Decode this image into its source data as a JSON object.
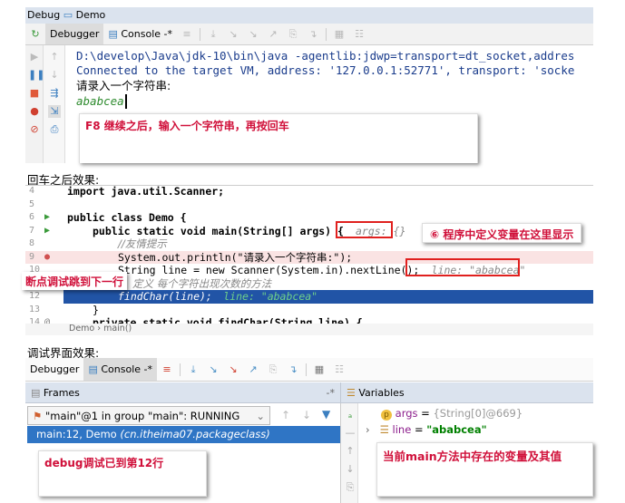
{
  "top": {
    "title_debug": "Debug",
    "title_config": "Demo",
    "tabs": [
      "Debugger",
      "Console"
    ],
    "console_lines": [
      "D:\\develop\\Java\\jdk-10\\bin\\java -agentlib:jdwp=transport=dt_socket,addres",
      "Connected to the target VM, address: '127.0.0.1:52771', transport: 'socke",
      "请录入一个字符串:"
    ],
    "input_value": "ababcea",
    "note": "F8 继续之后，输入一个字符串，再按回车"
  },
  "editor_section": {
    "label": "回车之后效果:",
    "lines": [
      {
        "n": "4",
        "code": "import java.util.Scanner;"
      },
      {
        "n": "5",
        "code": ""
      },
      {
        "n": "6",
        "code": "public class Demo {"
      },
      {
        "n": "7",
        "code": "public static void main(String[] args) {",
        "hint": "args: {}"
      },
      {
        "n": "8",
        "code": "//友情提示"
      },
      {
        "n": "9",
        "code": "System.out.println(\"请录入一个字符串:\");"
      },
      {
        "n": "10",
        "code": "String line = new Scanner(System.in).nextLine();",
        "hint": "line: \"ababcea\""
      },
      {
        "n": "11",
        "code": "定义 每个字符出现次数的方法"
      },
      {
        "n": "12",
        "code": "findChar(line);",
        "hint": "line: \"ababcea\""
      },
      {
        "n": "13",
        "code": "}"
      },
      {
        "n": "14",
        "code": "private static void findChar(String line) {"
      }
    ],
    "note_vars": "⑥ 程序中定义变量在这里显示",
    "note_step": "断点调试跳到下一行",
    "breadcrumb": [
      "Demo",
      "main()"
    ]
  },
  "debug_section": {
    "label": "调试界面效果:",
    "tabs": [
      "Debugger",
      "Console"
    ],
    "frames_title": "Frames",
    "variables_title": "Variables",
    "thread": "\"main\"@1 in group \"main\": RUNNING",
    "frame_selected": "main:12, Demo",
    "frame_package": "(cn.itheima07.packageclass)",
    "note_frames": "debug调试已到第12行",
    "variables": [
      {
        "name": "args",
        "eq": " = ",
        "value": "{String[0]@669}"
      },
      {
        "name": "line",
        "eq": " = ",
        "value": "\"ababcea\""
      }
    ],
    "note_vars": "当前main方法中存在的变量及其值"
  },
  "colors": {
    "selection": "#2154a6",
    "breakpoint_line": "#fae3e3",
    "note_text": "#d0103a",
    "annotation_box": "#e0201e"
  }
}
